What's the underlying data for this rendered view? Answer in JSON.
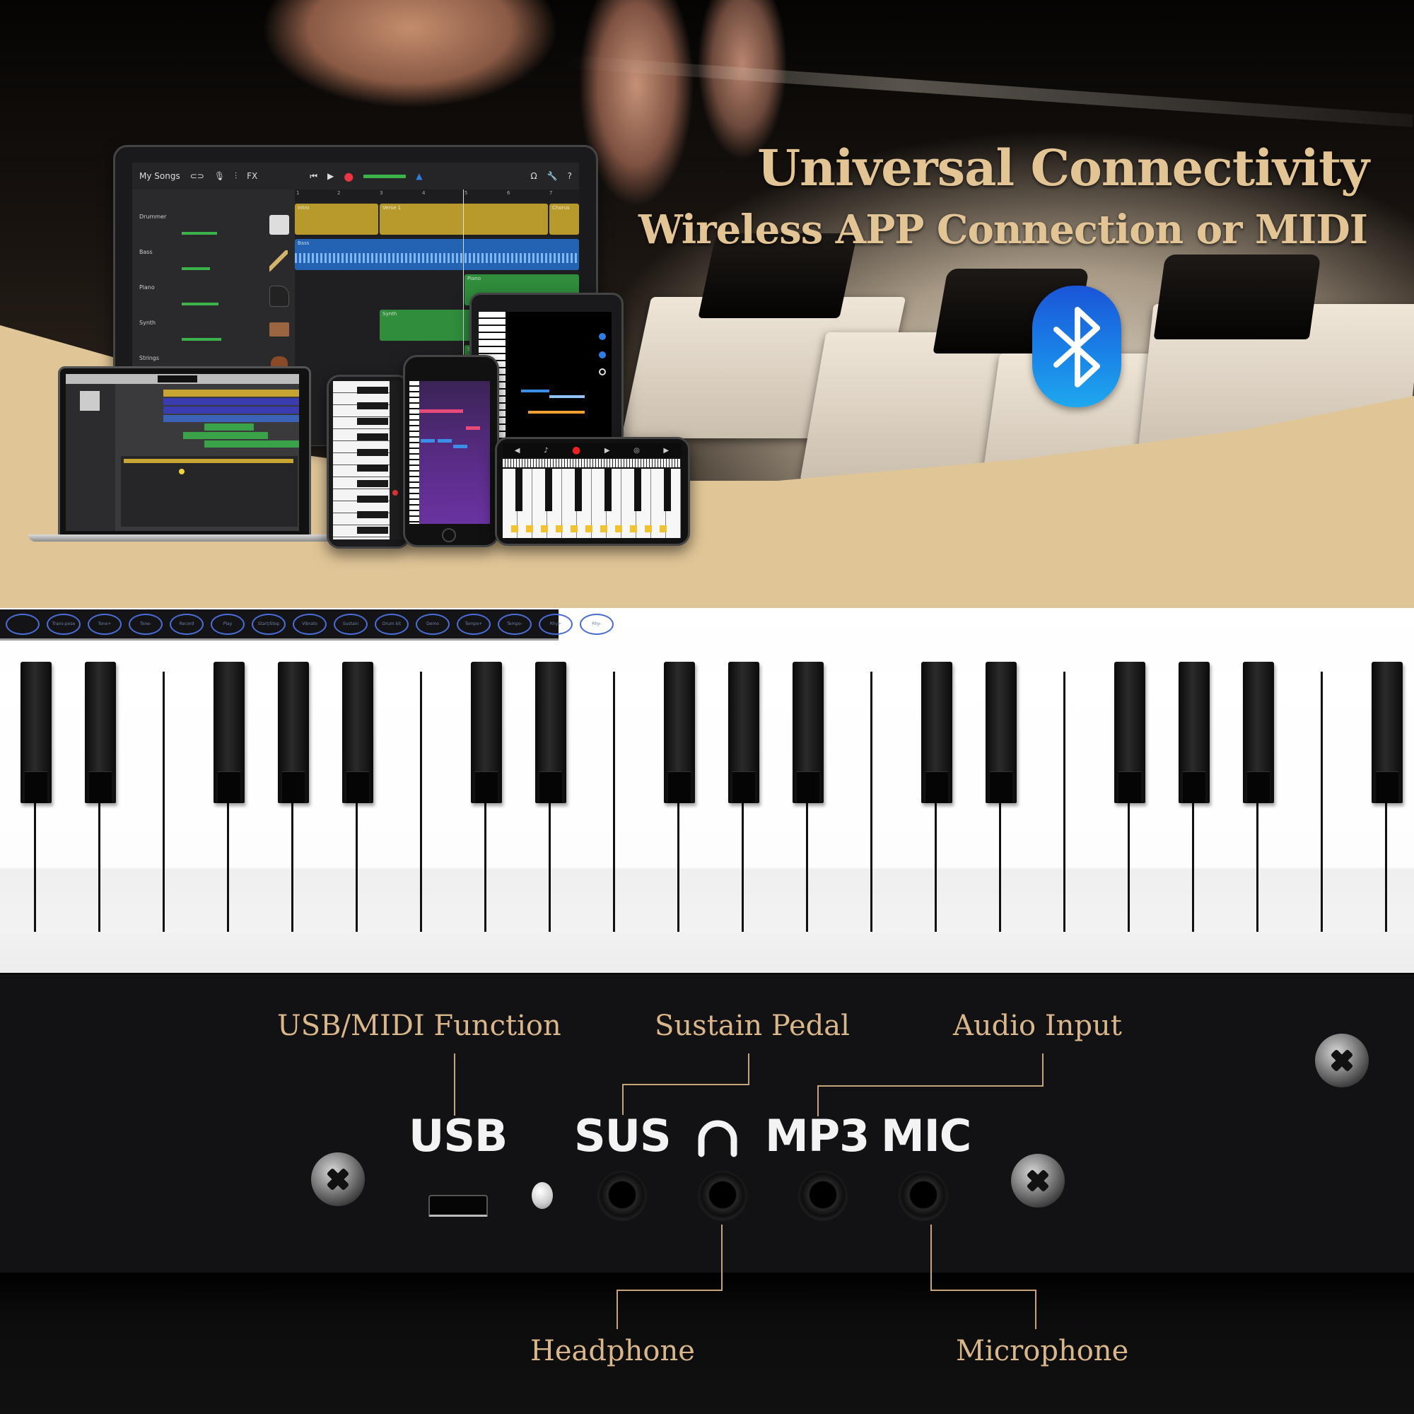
{
  "hero": {
    "title": "Universal Connectivity",
    "subtitle": "Wireless APP Connection or MIDI",
    "accent_color": "#e3c495",
    "bluetooth_icon": "bluetooth-icon",
    "bluetooth_color": "#1a6fe0"
  },
  "tablet_app": {
    "toolbar": {
      "my_songs": "My Songs",
      "fx": "FX"
    },
    "ruler": [
      "1",
      "2",
      "3",
      "4",
      "5",
      "6",
      "7"
    ],
    "tracks": [
      {
        "name": "Drummer",
        "icon": "drum-machine-icon"
      },
      {
        "name": "Bass",
        "icon": "bass-guitar-icon"
      },
      {
        "name": "Piano",
        "icon": "grand-piano-icon"
      },
      {
        "name": "Synth",
        "icon": "synth-icon"
      },
      {
        "name": "Strings",
        "icon": "violin-icon"
      }
    ],
    "regions": {
      "intro": "Intro",
      "verse": "Verse 1",
      "chorus": "Chorus",
      "bass": "Bass",
      "piano": "Piano",
      "synth": "Synth",
      "strings": "Strings"
    }
  },
  "panel_buttons": [
    "",
    "Trans-pose",
    "Tone+",
    "Tone-",
    "Record",
    "Play",
    "Start/Stop",
    "Vibrato",
    "Sustain",
    "Drum kit",
    "Demo",
    "Tempo+",
    "Tempo-",
    "Rhy+",
    "Rhy-"
  ],
  "ports": {
    "usb_label": "USB",
    "sus_label": "SUS",
    "headphone_symbol": "headphone-icon",
    "mp3_label": "MP3",
    "mic_label": "MIC"
  },
  "callouts": {
    "usb_midi": "USB/MIDI Function",
    "sustain": "Sustain Pedal",
    "audio_input": "Audio Input",
    "headphone": "Headphone",
    "microphone": "Microphone"
  }
}
